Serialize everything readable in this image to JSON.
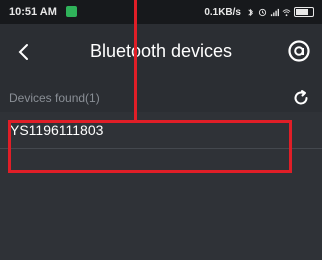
{
  "status_bar": {
    "time": "10:51 AM",
    "speed": "0.1KB/s",
    "icons": [
      "bluetooth-icon",
      "alarm-icon",
      "signal-icon",
      "wifi-icon",
      "battery-icon"
    ],
    "battery_text": "",
    "notification_color": "#2fb35a"
  },
  "header": {
    "title": "Bluetooth devices",
    "back_icon": "back-chevron-icon",
    "menu_icon": "menu-circle-icon"
  },
  "section": {
    "label": "Devices found(1)",
    "refresh_icon": "refresh-icon"
  },
  "devices": [
    {
      "name": "YS1196111803"
    }
  ],
  "colors": {
    "background": "#2b2e33",
    "list_background": "#2f3237",
    "status_bar": "#17191c",
    "annotation": "#e01e27",
    "secondary_text": "#8a8f96"
  }
}
